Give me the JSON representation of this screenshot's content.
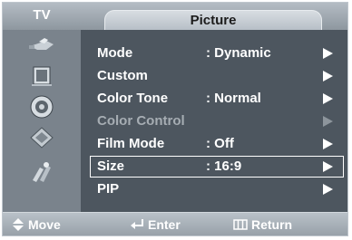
{
  "header": {
    "source": "TV",
    "title": "Picture"
  },
  "sidebar": {
    "icons": [
      "input-icon",
      "picture-icon",
      "sound-icon",
      "channel-icon",
      "setup-icon"
    ]
  },
  "menu": {
    "items": [
      {
        "label": "Mode",
        "value": ": Dynamic"
      },
      {
        "label": "Custom",
        "value": ""
      },
      {
        "label": "Color Tone",
        "value": ": Normal"
      },
      {
        "label": "Color Control",
        "value": ""
      },
      {
        "label": "Film Mode",
        "value": ": Off"
      },
      {
        "label": "Size",
        "value": ": 16:9"
      },
      {
        "label": "PIP",
        "value": ""
      }
    ]
  },
  "footer": {
    "move": "Move",
    "enter": "Enter",
    "return": "Return"
  }
}
